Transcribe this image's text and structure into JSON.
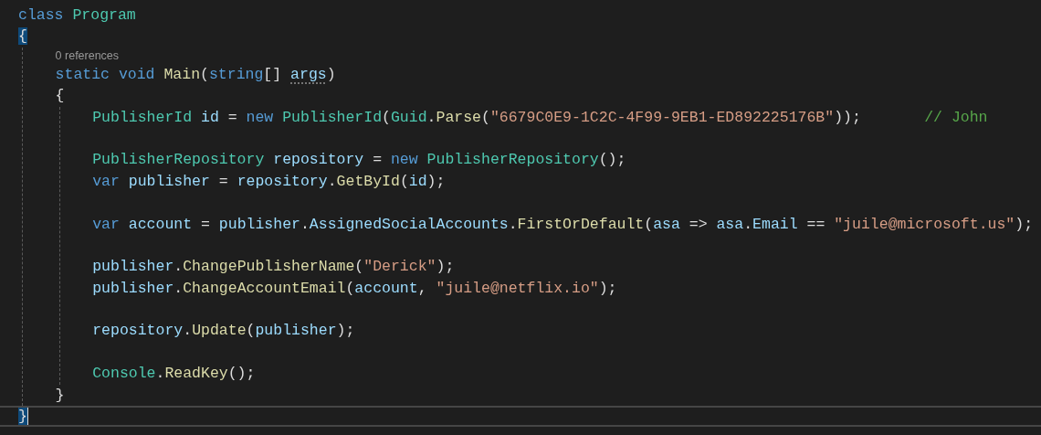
{
  "editor": {
    "items": [
      {
        "kind": "code",
        "tokens": [
          {
            "text": "class ",
            "kind": "kw"
          },
          {
            "text": "Program",
            "kind": "type"
          }
        ]
      },
      {
        "kind": "code",
        "tokens": [
          {
            "text": "{",
            "kind": "brace-match"
          }
        ]
      },
      {
        "kind": "block",
        "children": [
          {
            "kind": "lens",
            "text": "0 references"
          },
          {
            "kind": "code",
            "tokens": [
              {
                "text": "static void ",
                "kind": "kw"
              },
              {
                "text": "Main",
                "kind": "method"
              },
              {
                "text": "(",
                "kind": "punct"
              },
              {
                "text": "string",
                "kind": "kw"
              },
              {
                "text": "[] ",
                "kind": "punct"
              },
              {
                "text": "args",
                "kind": "param"
              },
              {
                "text": ")",
                "kind": "punct"
              }
            ]
          },
          {
            "kind": "code",
            "tokens": [
              {
                "text": "{",
                "kind": "punct"
              }
            ]
          },
          {
            "kind": "block",
            "children": [
              {
                "kind": "code",
                "tokens": [
                  {
                    "text": "PublisherId",
                    "kind": "type"
                  },
                  {
                    "text": " id ",
                    "kind": "var"
                  },
                  {
                    "text": "= ",
                    "kind": "punct"
                  },
                  {
                    "text": "new ",
                    "kind": "kw"
                  },
                  {
                    "text": "PublisherId",
                    "kind": "type"
                  },
                  {
                    "text": "(",
                    "kind": "punct"
                  },
                  {
                    "text": "Guid",
                    "kind": "type"
                  },
                  {
                    "text": ".",
                    "kind": "punct"
                  },
                  {
                    "text": "Parse",
                    "kind": "method"
                  },
                  {
                    "text": "(",
                    "kind": "punct"
                  },
                  {
                    "text": "\"6679C0E9-1C2C-4F99-9EB1-ED892225176B\"",
                    "kind": "str"
                  },
                  {
                    "text": "));       ",
                    "kind": "punct"
                  },
                  {
                    "text": "// John",
                    "kind": "comment"
                  }
                ]
              },
              {
                "kind": "blank"
              },
              {
                "kind": "code",
                "tokens": [
                  {
                    "text": "PublisherRepository",
                    "kind": "type"
                  },
                  {
                    "text": " repository ",
                    "kind": "var"
                  },
                  {
                    "text": "= ",
                    "kind": "punct"
                  },
                  {
                    "text": "new ",
                    "kind": "kw"
                  },
                  {
                    "text": "PublisherRepository",
                    "kind": "type"
                  },
                  {
                    "text": "();",
                    "kind": "punct"
                  }
                ]
              },
              {
                "kind": "code",
                "tokens": [
                  {
                    "text": "var ",
                    "kind": "kw"
                  },
                  {
                    "text": "publisher ",
                    "kind": "var"
                  },
                  {
                    "text": "= ",
                    "kind": "punct"
                  },
                  {
                    "text": "repository",
                    "kind": "var"
                  },
                  {
                    "text": ".",
                    "kind": "punct"
                  },
                  {
                    "text": "GetById",
                    "kind": "method"
                  },
                  {
                    "text": "(",
                    "kind": "punct"
                  },
                  {
                    "text": "id",
                    "kind": "var"
                  },
                  {
                    "text": ");",
                    "kind": "punct"
                  }
                ]
              },
              {
                "kind": "blank"
              },
              {
                "kind": "code",
                "tokens": [
                  {
                    "text": "var ",
                    "kind": "kw"
                  },
                  {
                    "text": "account ",
                    "kind": "var"
                  },
                  {
                    "text": "= ",
                    "kind": "punct"
                  },
                  {
                    "text": "publisher",
                    "kind": "var"
                  },
                  {
                    "text": ".",
                    "kind": "punct"
                  },
                  {
                    "text": "AssignedSocialAccounts",
                    "kind": "var"
                  },
                  {
                    "text": ".",
                    "kind": "punct"
                  },
                  {
                    "text": "FirstOrDefault",
                    "kind": "method"
                  },
                  {
                    "text": "(",
                    "kind": "punct"
                  },
                  {
                    "text": "asa",
                    "kind": "var"
                  },
                  {
                    "text": " => ",
                    "kind": "punct"
                  },
                  {
                    "text": "asa",
                    "kind": "var"
                  },
                  {
                    "text": ".",
                    "kind": "punct"
                  },
                  {
                    "text": "Email",
                    "kind": "var"
                  },
                  {
                    "text": " == ",
                    "kind": "punct"
                  },
                  {
                    "text": "\"juile@microsoft.us\"",
                    "kind": "str"
                  },
                  {
                    "text": ");",
                    "kind": "punct"
                  }
                ]
              },
              {
                "kind": "blank"
              },
              {
                "kind": "code",
                "tokens": [
                  {
                    "text": "publisher",
                    "kind": "var"
                  },
                  {
                    "text": ".",
                    "kind": "punct"
                  },
                  {
                    "text": "ChangePublisherName",
                    "kind": "method"
                  },
                  {
                    "text": "(",
                    "kind": "punct"
                  },
                  {
                    "text": "\"Derick\"",
                    "kind": "str"
                  },
                  {
                    "text": ");",
                    "kind": "punct"
                  }
                ]
              },
              {
                "kind": "code",
                "tokens": [
                  {
                    "text": "publisher",
                    "kind": "var"
                  },
                  {
                    "text": ".",
                    "kind": "punct"
                  },
                  {
                    "text": "ChangeAccountEmail",
                    "kind": "method"
                  },
                  {
                    "text": "(",
                    "kind": "punct"
                  },
                  {
                    "text": "account",
                    "kind": "var"
                  },
                  {
                    "text": ", ",
                    "kind": "punct"
                  },
                  {
                    "text": "\"juile@netflix.io\"",
                    "kind": "str"
                  },
                  {
                    "text": ");",
                    "kind": "punct"
                  }
                ]
              },
              {
                "kind": "blank"
              },
              {
                "kind": "code",
                "tokens": [
                  {
                    "text": "repository",
                    "kind": "var"
                  },
                  {
                    "text": ".",
                    "kind": "punct"
                  },
                  {
                    "text": "Update",
                    "kind": "method"
                  },
                  {
                    "text": "(",
                    "kind": "punct"
                  },
                  {
                    "text": "publisher",
                    "kind": "var"
                  },
                  {
                    "text": ");",
                    "kind": "punct"
                  }
                ]
              },
              {
                "kind": "blank"
              },
              {
                "kind": "code",
                "tokens": [
                  {
                    "text": "Console",
                    "kind": "type"
                  },
                  {
                    "text": ".",
                    "kind": "punct"
                  },
                  {
                    "text": "ReadKey",
                    "kind": "method"
                  },
                  {
                    "text": "();",
                    "kind": "punct"
                  }
                ]
              }
            ]
          },
          {
            "kind": "code",
            "tokens": [
              {
                "text": "}",
                "kind": "punct"
              }
            ]
          }
        ]
      },
      {
        "kind": "code",
        "current": true,
        "tokens": [
          {
            "text": "}",
            "kind": "brace-match"
          }
        ]
      }
    ]
  }
}
